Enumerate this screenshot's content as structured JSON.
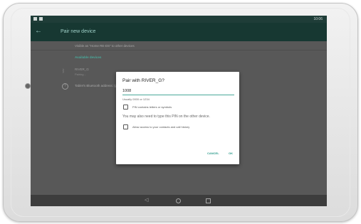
{
  "status_bar": {
    "time": "10:06"
  },
  "app_bar": {
    "title": "Pair new device"
  },
  "content": {
    "visible_as": "Visible as “Home RE-DS” to other devices",
    "section_header": "Available devices",
    "device": {
      "name": "RIVER_G",
      "status": "Pairing..."
    },
    "help": "Tablet's Bluetooth address: (partially hidden)"
  },
  "dialog": {
    "title": "Pair with RIVER_G?",
    "pin_value": "1008",
    "pin_hint": "Usually 0000 or 1234",
    "checkbox_pin": "PIN contains letters or symbols",
    "note": "You may also need to type this PIN on the other device.",
    "checkbox_contacts": "Allow access to your contacts and call history",
    "cancel_label": "CANCEL",
    "ok_label": "OK"
  },
  "colors": {
    "accent": "#2e9c8c",
    "appbar": "#173832",
    "scrim": "#585858"
  }
}
